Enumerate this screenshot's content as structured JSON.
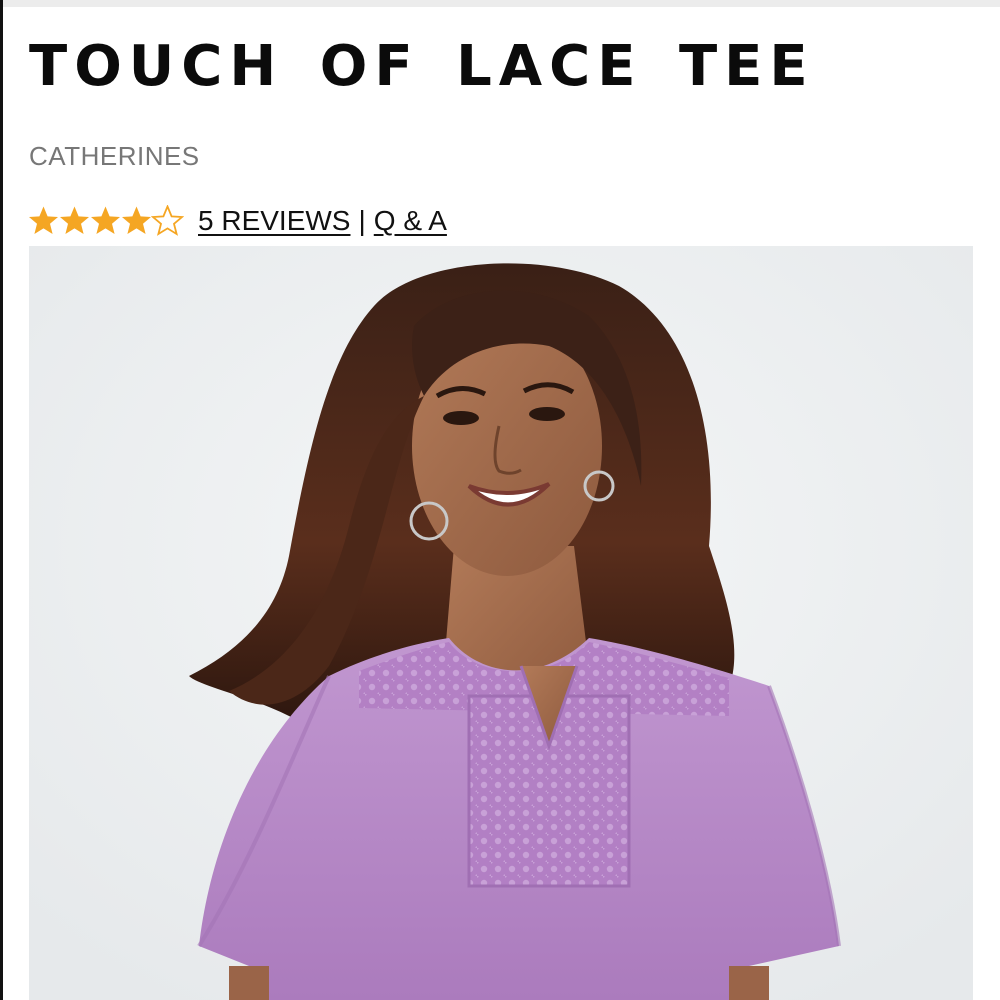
{
  "product": {
    "title": "TOUCH OF LACE TEE",
    "brand": "CATHERINES"
  },
  "rating": {
    "value": 4,
    "max": 5,
    "star_color": "#F5A623",
    "empty_star_color": "#F5A623",
    "reviews_label": "5 REVIEWS",
    "separator": "|",
    "qa_label": "Q & A"
  },
  "image": {
    "subject": "model wearing lavender lace-yoke tee",
    "background_color": "#EEF0F1",
    "shirt_color": "#B889C8"
  }
}
